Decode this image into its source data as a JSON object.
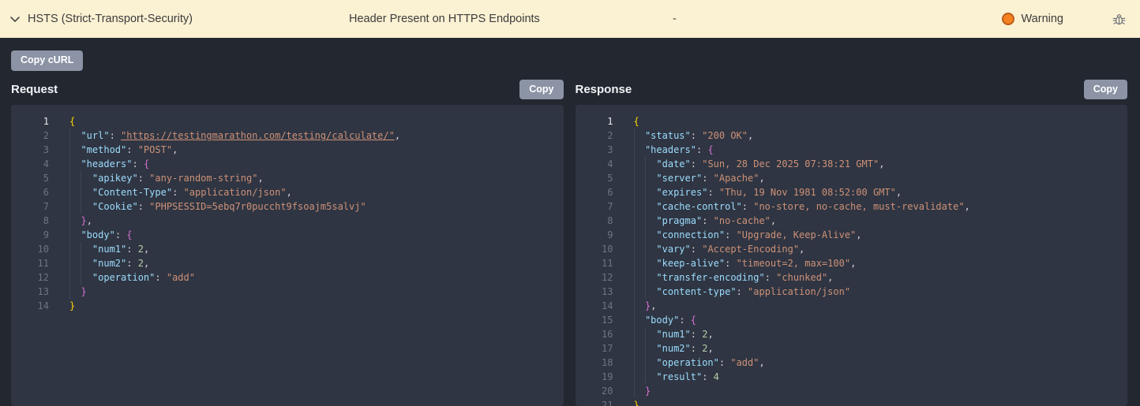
{
  "finding": {
    "name": "HSTS (Strict-Transport-Security)",
    "description": "Header Present on HTTPS Endpoints",
    "endpoint": "-",
    "status": {
      "label": "Warning",
      "color": "#f5821e"
    },
    "chevron_icon": "chevron-down",
    "bug_icon": "bug"
  },
  "toolbar": {
    "copy_curl_label": "Copy cURL"
  },
  "panels": [
    {
      "title": "Request",
      "copy_label": "Copy",
      "code_lines": [
        "{",
        "  \"url\": \"https://testingmarathon.com/testing/calculate/\",",
        "  \"method\": \"POST\",",
        "  \"headers\": {",
        "    \"apikey\": \"any-random-string\",",
        "    \"Content-Type\": \"application/json\",",
        "    \"Cookie\": \"PHPSESSID=5ebq7r0puccht9fsoajm5salvj\"",
        "  },",
        "  \"body\": {",
        "    \"num1\": 2,",
        "    \"num2\": 2,",
        "    \"operation\": \"add\"",
        "  }",
        "}"
      ]
    },
    {
      "title": "Response",
      "copy_label": "Copy",
      "code_lines": [
        "{",
        "  \"status\": \"200 OK\",",
        "  \"headers\": {",
        "    \"date\": \"Sun, 28 Dec 2025 07:38:21 GMT\",",
        "    \"server\": \"Apache\",",
        "    \"expires\": \"Thu, 19 Nov 1981 08:52:00 GMT\",",
        "    \"cache-control\": \"no-store, no-cache, must-revalidate\",",
        "    \"pragma\": \"no-cache\",",
        "    \"connection\": \"Upgrade, Keep-Alive\",",
        "    \"vary\": \"Accept-Encoding\",",
        "    \"keep-alive\": \"timeout=2, max=100\",",
        "    \"transfer-encoding\": \"chunked\",",
        "    \"content-type\": \"application/json\"",
        "  },",
        "  \"body\": {",
        "    \"num1\": 2,",
        "    \"num2\": 2,",
        "    \"operation\": \"add\",",
        "    \"result\": 4",
        "  }",
        "}"
      ]
    }
  ]
}
